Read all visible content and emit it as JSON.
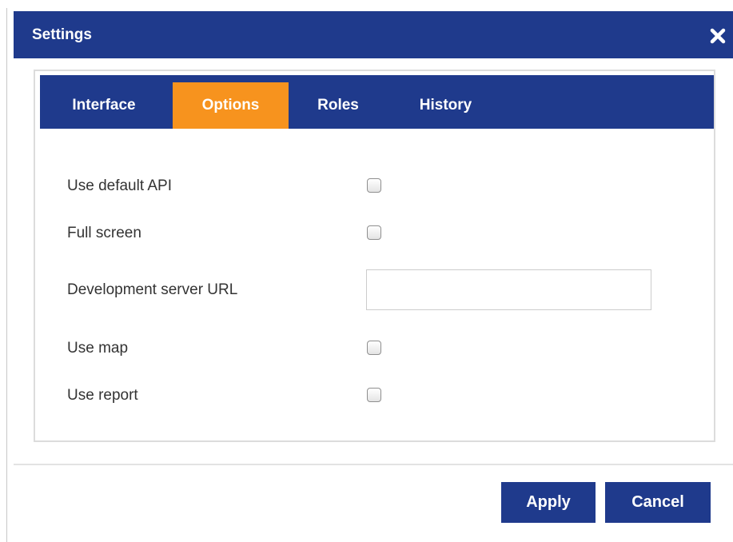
{
  "dialog": {
    "title": "Settings",
    "close_icon": "close-icon",
    "colors": {
      "header": "#1f3a8c",
      "active_tab": "#f7931e",
      "text": "#333333"
    }
  },
  "tabs": [
    {
      "label": "Interface",
      "active": false
    },
    {
      "label": "Options",
      "active": true
    },
    {
      "label": "Roles",
      "active": false
    },
    {
      "label": "History",
      "active": false
    }
  ],
  "options": {
    "use_default_api": {
      "label": "Use default API",
      "checked": false
    },
    "full_screen": {
      "label": "Full screen",
      "checked": false
    },
    "dev_server_url": {
      "label": "Development server URL",
      "value": "",
      "placeholder": ""
    },
    "use_map": {
      "label": "Use map",
      "checked": false
    },
    "use_report": {
      "label": "Use report",
      "checked": false
    }
  },
  "footer": {
    "apply_label": "Apply",
    "cancel_label": "Cancel"
  }
}
